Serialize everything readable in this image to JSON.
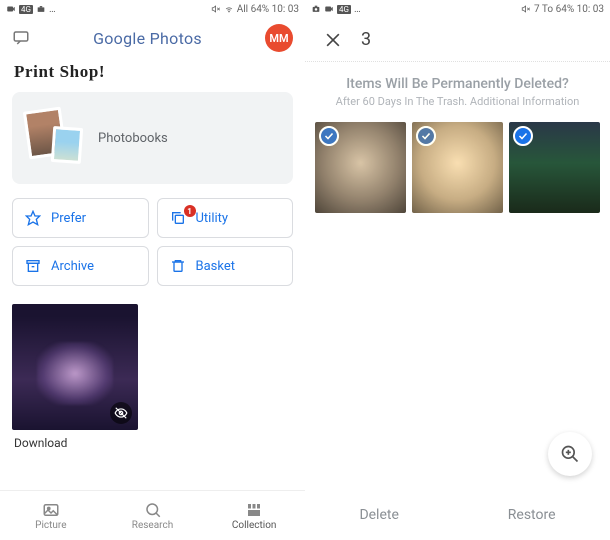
{
  "left": {
    "statusbar": {
      "left_icons": "CC 4G 65 …",
      "right_text": "All 64% 10: 03",
      "mute_icon": true,
      "wifi_icon": true
    },
    "header": {
      "comment_icon": "comment-icon",
      "title": "Google Photos",
      "avatar_initials": "MM"
    },
    "section_title": "Print Shop!",
    "promo": {
      "label": "Photobooks"
    },
    "actions": {
      "prefer": "Prefer",
      "utility": "Utility",
      "utility_badge": "1",
      "archive": "Archive",
      "basket": "Basket"
    },
    "hidden_thumb_label": "Download",
    "bottom_nav": {
      "picture": "Picture",
      "research": "Research",
      "collection": "Collection"
    }
  },
  "right": {
    "statusbar": {
      "left_icons": "📷 CC 4G …",
      "right_text": "7 To 64% 10: 03",
      "mute_icon": true
    },
    "selection": {
      "count": "3"
    },
    "warning": {
      "title": "Items Will Be Permanently Deleted?",
      "subtitle": "After 60 Days In The Trash. Additional Information"
    },
    "actions": {
      "delete": "Delete",
      "restore": "Restore"
    }
  }
}
